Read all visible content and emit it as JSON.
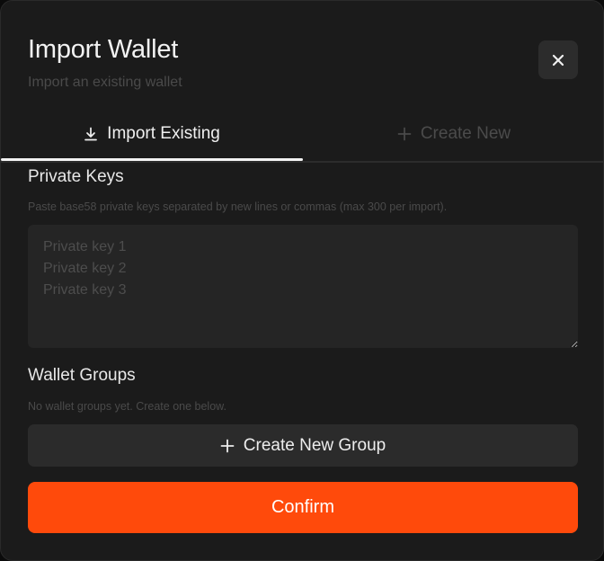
{
  "dialog": {
    "title": "Import Wallet",
    "subtitle": "Import an existing wallet",
    "close_icon": "close-icon"
  },
  "tabs": [
    {
      "label": "Import Existing",
      "icon": "download-icon",
      "active": true
    },
    {
      "label": "Create New",
      "icon": "plus-icon",
      "active": false
    }
  ],
  "private_keys": {
    "label": "Private Keys",
    "hint": "Paste base58 private keys separated by new lines or commas (max 300 per import).",
    "value": "",
    "placeholder": "Private key 1\nPrivate key 2\nPrivate key 3"
  },
  "wallet_groups": {
    "label": "Wallet Groups",
    "empty_text": "No wallet groups yet. Create one below.",
    "create_button_label": "Create New Group",
    "create_button_icon": "plus-icon"
  },
  "confirm_label": "Confirm",
  "colors": {
    "background": "#1b1b1b",
    "accent": "#ff4a0b",
    "input_bg": "#252525",
    "button_bg": "#2b2b2b"
  }
}
